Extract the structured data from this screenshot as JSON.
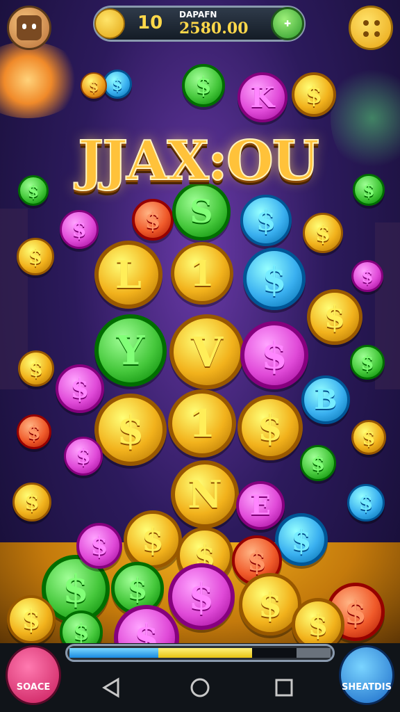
{
  "top_bar": {
    "coin_count": "10",
    "label": "DAPAFN",
    "amount": "2580.00"
  },
  "title": "JJAX:OU",
  "bottom_bar": {
    "progress": {
      "blue": 0.34,
      "yellow": 0.36,
      "dark": 0.17,
      "gray": 0.13
    },
    "left_button_label": "SOACE",
    "right_button_label": "SHEATDIS"
  },
  "coins": [
    {
      "glyph": "$",
      "color": "#3ab0f0"
    },
    {
      "glyph": "$",
      "color": "#46c83c"
    },
    {
      "glyph": "K",
      "color": "#e04ad8"
    },
    {
      "glyph": "$",
      "color": "#f2b21c"
    },
    {
      "glyph": "$",
      "color": "#f0a020"
    },
    {
      "glyph": "$",
      "color": "#44c83a"
    },
    {
      "glyph": "$",
      "color": "#f05a2a"
    },
    {
      "glyph": "S",
      "color": "#46c83c"
    },
    {
      "glyph": "$",
      "color": "#3ab0f0"
    },
    {
      "glyph": "$",
      "color": "#f2b21c"
    },
    {
      "glyph": "$",
      "color": "#e04ad8"
    },
    {
      "glyph": "$",
      "color": "#44c83a"
    },
    {
      "glyph": "$",
      "color": "#f2b21c"
    },
    {
      "glyph": "L",
      "color": "#f2b21c"
    },
    {
      "glyph": "1",
      "color": "#f2b21c"
    },
    {
      "glyph": "$",
      "color": "#3ab0f0"
    },
    {
      "glyph": "$",
      "color": "#f2b21c"
    },
    {
      "glyph": "$",
      "color": "#e04ad8"
    },
    {
      "glyph": "Y",
      "color": "#46c83c"
    },
    {
      "glyph": "V",
      "color": "#f2b21c"
    },
    {
      "glyph": "$",
      "color": "#e04ad8"
    },
    {
      "glyph": "$",
      "color": "#f2b21c"
    },
    {
      "glyph": "$",
      "color": "#44c83a"
    },
    {
      "glyph": "$",
      "color": "#e04ad8"
    },
    {
      "glyph": "$",
      "color": "#f2b21c"
    },
    {
      "glyph": "1",
      "color": "#f2b21c"
    },
    {
      "glyph": "$",
      "color": "#f2b21c"
    },
    {
      "glyph": "B",
      "color": "#3ab0f0"
    },
    {
      "glyph": "$",
      "color": "#f05a2a"
    },
    {
      "glyph": "$",
      "color": "#f2b21c"
    },
    {
      "glyph": "$",
      "color": "#e04ad8"
    },
    {
      "glyph": "$",
      "color": "#46c83c"
    },
    {
      "glyph": "N",
      "color": "#f2b21c"
    },
    {
      "glyph": "E",
      "color": "#e04ad8"
    },
    {
      "glyph": "$",
      "color": "#f2b21c"
    },
    {
      "glyph": "$",
      "color": "#3ab0f0"
    },
    {
      "glyph": "$",
      "color": "#f2b21c"
    },
    {
      "glyph": "$",
      "color": "#3ab0f0"
    },
    {
      "glyph": "$",
      "color": "#46c83c"
    },
    {
      "glyph": "$",
      "color": "#e04ad8"
    },
    {
      "glyph": "$",
      "color": "#f2b21c"
    },
    {
      "glyph": "$",
      "color": "#f05a2a"
    },
    {
      "glyph": "$",
      "color": "#46c83c"
    },
    {
      "glyph": "$",
      "color": "#e04ad8"
    },
    {
      "glyph": "$",
      "color": "#f2b21c"
    },
    {
      "glyph": "$",
      "color": "#f05a2a"
    },
    {
      "glyph": "$",
      "color": "#f2b21c"
    },
    {
      "glyph": "$",
      "color": "#46c83c"
    },
    {
      "glyph": "$",
      "color": "#e04ad8"
    },
    {
      "glyph": "$",
      "color": "#f2b21c"
    }
  ]
}
